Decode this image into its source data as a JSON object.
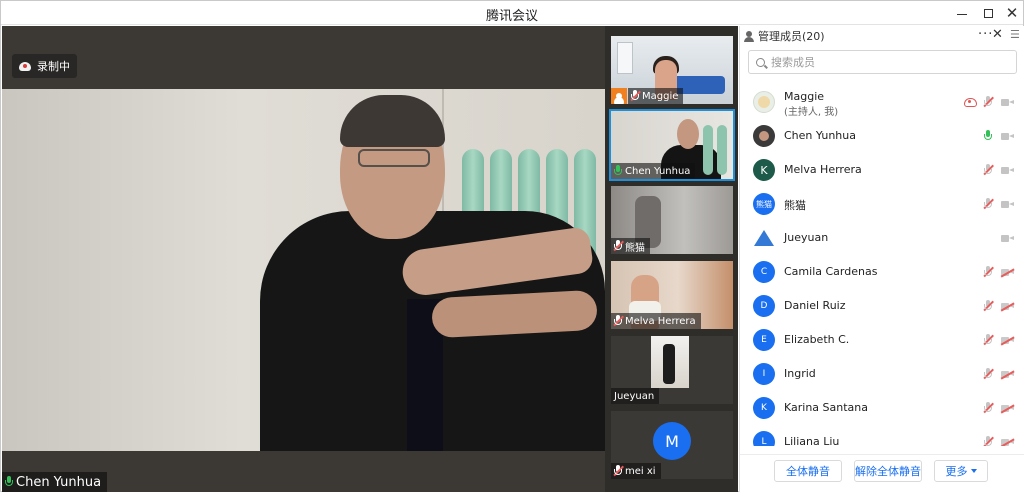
{
  "window": {
    "title": "腾讯会议"
  },
  "stage": {
    "recording_label": "录制中",
    "speaker_name": "Chen Yunhua"
  },
  "thumbnails": [
    {
      "name": "Maggie",
      "mic": "speaking"
    },
    {
      "name": "Chen Yunhua",
      "mic": "on",
      "active": true
    },
    {
      "name": "熊猫",
      "mic": "muted"
    },
    {
      "name": "Melva Herrera",
      "mic": "muted"
    },
    {
      "name": "Jueyuan",
      "mic": "none"
    },
    {
      "name": "mei xi",
      "mic": "muted",
      "avatar_letter": "M"
    }
  ],
  "panel": {
    "title": "管理成员(20)",
    "more": "···",
    "search_placeholder": "搜索成员",
    "members": [
      {
        "name": "Maggie",
        "sub": "(主持人, 我)",
        "avatar": "",
        "avatar_color": "#e9efe6",
        "mic": "muted",
        "cam": "on",
        "recording": true
      },
      {
        "name": "Chen Yunhua",
        "avatar": "",
        "avatar_color": "#3a3a3a",
        "mic": "active",
        "cam": "on"
      },
      {
        "name": "Melva Herrera",
        "avatar": "K",
        "avatar_color": "#1d5a4a",
        "mic": "muted",
        "cam": "on"
      },
      {
        "name": "熊猫",
        "avatar": "熊猫",
        "avatar_color": "#1a6ff0",
        "mic": "muted",
        "cam": "on"
      },
      {
        "name": "Jueyuan",
        "avatar": "",
        "avatar_color": "triangle",
        "mic": "none",
        "cam": "on"
      },
      {
        "name": "Camila Cardenas",
        "avatar": "C",
        "avatar_color": "#1a6ff0",
        "mic": "muted",
        "cam": "off"
      },
      {
        "name": "Daniel Ruiz",
        "avatar": "D",
        "avatar_color": "#1a6ff0",
        "mic": "muted",
        "cam": "off"
      },
      {
        "name": "Elizabeth C.",
        "avatar": "E",
        "avatar_color": "#1a6ff0",
        "mic": "muted",
        "cam": "off"
      },
      {
        "name": "Ingrid",
        "avatar": "I",
        "avatar_color": "#1a6ff0",
        "mic": "muted",
        "cam": "off"
      },
      {
        "name": "Karina Santana",
        "avatar": "K",
        "avatar_color": "#1a6ff0",
        "mic": "muted",
        "cam": "off"
      },
      {
        "name": "Liliana Liu",
        "avatar": "L",
        "avatar_color": "#1a6ff0",
        "mic": "muted",
        "cam": "off"
      }
    ],
    "buttons": {
      "mute_all": "全体静音",
      "unmute_all": "解除全体静音",
      "more": "更多"
    }
  },
  "colors": {
    "accent": "#1a6ff0",
    "mic_active": "#35c05a",
    "muted": "#e85c5c",
    "stage_bg": "#3c3935"
  },
  "icons": [
    "minimize-icon",
    "maximize-icon",
    "close-icon",
    "cloud-record-icon",
    "microphone-icon",
    "camera-icon",
    "search-icon",
    "person-icon",
    "menu-icon"
  ]
}
